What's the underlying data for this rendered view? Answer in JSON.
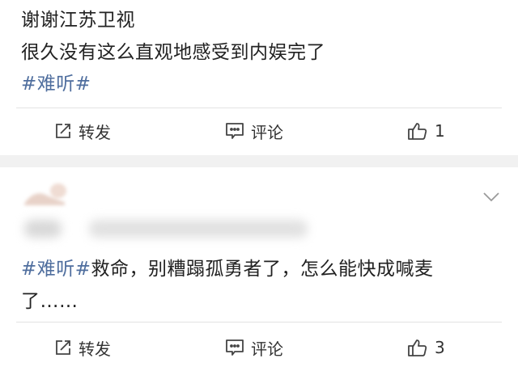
{
  "post1": {
    "line1": "谢谢江苏卫视",
    "line2": "很久没有这么直观地感受到内娱完了",
    "hashtag": "#难听#",
    "actions": {
      "repost": "转发",
      "comment": "评论",
      "likes": "1"
    }
  },
  "post2": {
    "hashtag": "#难听#",
    "text_line1": "救命，别糟蹋孤勇者了，怎么能快成喊麦",
    "text_line2": "了……",
    "actions": {
      "repost": "转发",
      "comment": "评论",
      "likes": "3"
    }
  },
  "colors": {
    "hashtag": "#4f6e9e",
    "separator": "#f1f1f1"
  },
  "icons": [
    "repost-icon",
    "comment-icon",
    "like-icon",
    "chevron-down-icon"
  ]
}
